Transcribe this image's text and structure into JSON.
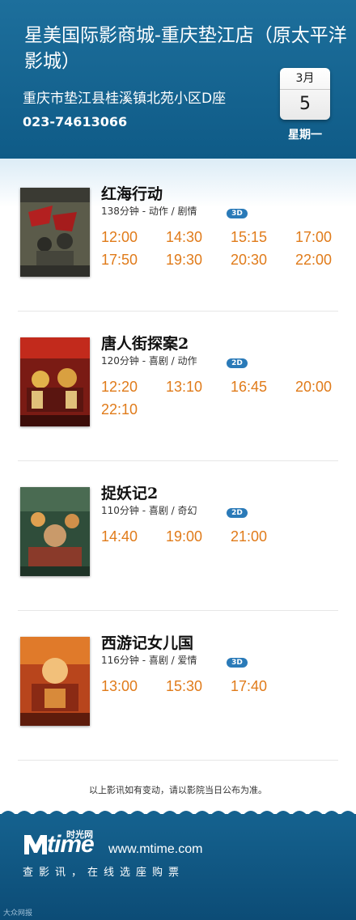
{
  "cinema": {
    "name": "星美国际影商城-重庆垫江店（原太平洋影城）",
    "address": "重庆市垫江县桂溪镇北苑小区D座",
    "phone": "023-74613066"
  },
  "date": {
    "month": "3月",
    "day": "5",
    "weekday": "星期一"
  },
  "movies": [
    {
      "title": "红海行动",
      "meta": "138分钟 - 动作 / 剧情",
      "format": "3D",
      "times": [
        "12:00",
        "14:30",
        "15:15",
        "17:00",
        "17:50",
        "19:30",
        "20:30",
        "22:00"
      ]
    },
    {
      "title": "唐人街探案2",
      "meta": "120分钟 - 喜剧 / 动作",
      "format": "2D",
      "times": [
        "12:20",
        "13:10",
        "16:45",
        "20:00",
        "22:10"
      ]
    },
    {
      "title": "捉妖记2",
      "meta": "110分钟 - 喜剧 / 奇幻",
      "format": "2D",
      "times": [
        "14:40",
        "19:00",
        "21:00"
      ]
    },
    {
      "title": "西游记女儿国",
      "meta": "116分钟 - 喜剧 / 爱情",
      "format": "3D",
      "times": [
        "13:00",
        "15:30",
        "17:40"
      ]
    }
  ],
  "notice": "以上影讯如有变动，请以影院当日公布为准。",
  "footer": {
    "brand": "time",
    "brand_cn": "时光网",
    "url": "www.mtime.com",
    "tagline": "查影讯，在线选座购票",
    "watermark": "大众网报"
  },
  "colors": {
    "header_blue": "#0f5b87",
    "showtime_orange": "#e07b1a",
    "badge_blue": "#2a7ab8"
  }
}
